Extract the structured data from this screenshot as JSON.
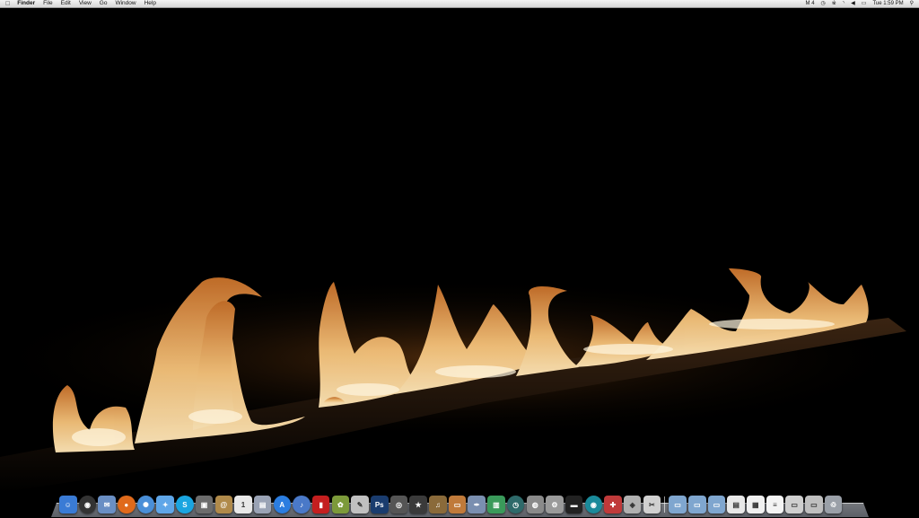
{
  "menubar": {
    "apple_icon": "apple-logo-icon",
    "items": [
      "Finder",
      "File",
      "Edit",
      "View",
      "Go",
      "Window",
      "Help"
    ],
    "status": {
      "app_badge": "M 4",
      "clock": "Tue 1:59 PM",
      "icons": [
        "time-machine-icon",
        "bluetooth-icon",
        "wifi-icon",
        "volume-icon",
        "battery-icon",
        "spotlight-icon"
      ]
    }
  },
  "desktop": {
    "wallpaper": "fire-flames"
  },
  "dock": {
    "apps": [
      {
        "icon": "finder-icon",
        "color": "#3a7bd5",
        "glyph": "☺"
      },
      {
        "icon": "dashboard-icon",
        "color": "#333333",
        "glyph": "◉"
      },
      {
        "icon": "mail-icon",
        "color": "#6a8fc4",
        "glyph": "✉"
      },
      {
        "icon": "firefox-icon",
        "color": "#e06a1b",
        "glyph": "●"
      },
      {
        "icon": "safari-icon",
        "color": "#4a8fd8",
        "glyph": "✺"
      },
      {
        "icon": "ichat-icon",
        "color": "#5fa6e8",
        "glyph": "✦"
      },
      {
        "icon": "skype-icon",
        "color": "#1aa5e0",
        "glyph": "S"
      },
      {
        "icon": "facetime-icon",
        "color": "#6c6c6c",
        "glyph": "▣"
      },
      {
        "icon": "address-book-icon",
        "color": "#b08a4a",
        "glyph": "@"
      },
      {
        "icon": "ical-icon",
        "color": "#e8e8e8",
        "glyph": "1"
      },
      {
        "icon": "preview-icon",
        "color": "#9aa3b5",
        "glyph": "▤"
      },
      {
        "icon": "app-store-icon",
        "color": "#2b7de0",
        "glyph": "A"
      },
      {
        "icon": "itunes-icon",
        "color": "#4a79c8",
        "glyph": "♪"
      },
      {
        "icon": "photo-booth-icon",
        "color": "#c41f1f",
        "glyph": "▮"
      },
      {
        "icon": "iphoto-icon",
        "color": "#7c9a3a",
        "glyph": "✿"
      },
      {
        "icon": "textedit-icon",
        "color": "#c0c0c0",
        "glyph": "✎"
      },
      {
        "icon": "photoshop-icon",
        "color": "#1a3c6e",
        "glyph": "Ps"
      },
      {
        "icon": "aperture-icon",
        "color": "#555555",
        "glyph": "◎"
      },
      {
        "icon": "imovie-icon",
        "color": "#3a3a3a",
        "glyph": "★"
      },
      {
        "icon": "garageband-icon",
        "color": "#8a6a3a",
        "glyph": "♫"
      },
      {
        "icon": "keynote-icon",
        "color": "#c07a3a",
        "glyph": "▭"
      },
      {
        "icon": "pages-icon",
        "color": "#7a8fb0",
        "glyph": "✒"
      },
      {
        "icon": "numbers-icon",
        "color": "#3a9a5a",
        "glyph": "▥"
      },
      {
        "icon": "time-machine-icon",
        "color": "#2e6a6a",
        "glyph": "◷"
      },
      {
        "icon": "disk-utility-icon",
        "color": "#8a8a8a",
        "glyph": "◍"
      },
      {
        "icon": "system-preferences-icon",
        "color": "#9a9a9a",
        "glyph": "⚙"
      },
      {
        "icon": "terminal-icon",
        "color": "#222222",
        "glyph": "▬"
      },
      {
        "icon": "network-utility-icon",
        "color": "#1a8a9a",
        "glyph": "◉"
      },
      {
        "icon": "maps-icon",
        "color": "#c03a3a",
        "glyph": "✚"
      },
      {
        "icon": "utility-icon",
        "color": "#b0b0b0",
        "glyph": "◈"
      },
      {
        "icon": "script-editor-icon",
        "color": "#d0d0d0",
        "glyph": "✂"
      }
    ],
    "stacks": [
      {
        "icon": "applications-folder-icon",
        "color": "#7fa6cf",
        "glyph": "▭"
      },
      {
        "icon": "documents-folder-icon",
        "color": "#7fa6cf",
        "glyph": "▭"
      },
      {
        "icon": "downloads-folder-icon",
        "color": "#7fa6cf",
        "glyph": "▭"
      },
      {
        "icon": "document-stack-icon",
        "color": "#e8e8e8",
        "glyph": "▤"
      },
      {
        "icon": "spreadsheet-stack-icon",
        "color": "#f0f0f0",
        "glyph": "▦"
      },
      {
        "icon": "text-stack-icon",
        "color": "#f4f4f4",
        "glyph": "≡"
      },
      {
        "icon": "screenshot-stack-icon",
        "color": "#cfcfcf",
        "glyph": "▭"
      },
      {
        "icon": "image-stack-icon",
        "color": "#bfbfbf",
        "glyph": "▭"
      },
      {
        "icon": "trash-icon",
        "color": "#9aa0a8",
        "glyph": "♲"
      }
    ]
  }
}
